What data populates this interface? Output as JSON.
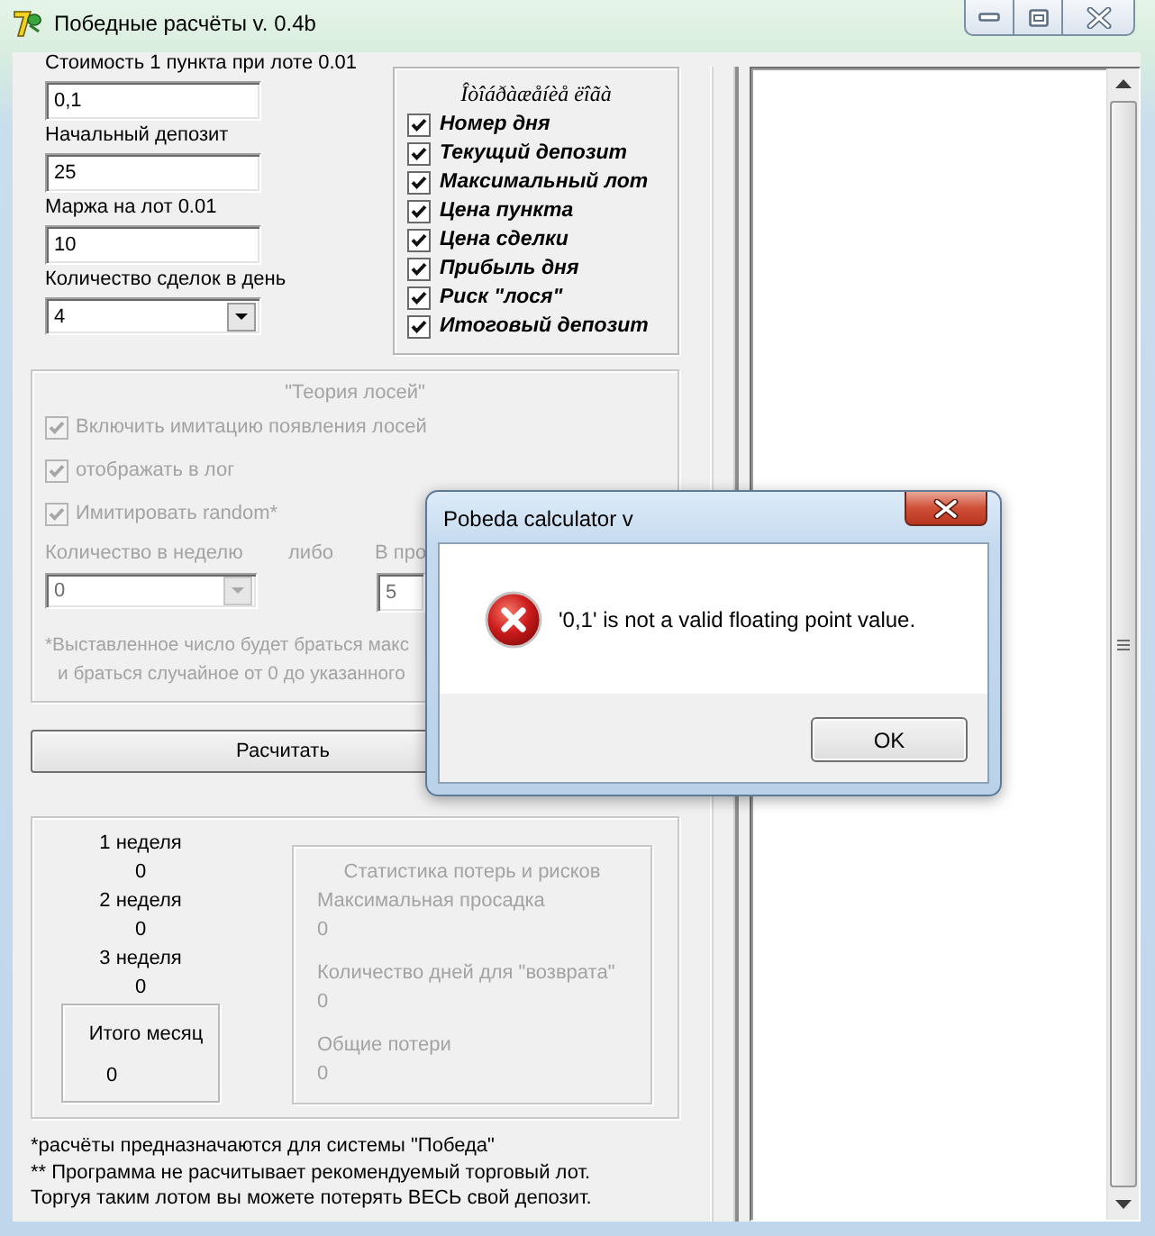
{
  "window": {
    "title": "Победные расчёты v. 0.4b"
  },
  "inputs": [
    {
      "label": "Стоимость 1 пункта при лоте 0.01",
      "kind": "text",
      "value": "0,1"
    },
    {
      "label": "Начальный депозит",
      "kind": "text",
      "value": "25"
    },
    {
      "label": "Маржа на лот 0.01",
      "kind": "text",
      "value": "10"
    },
    {
      "label": "Количество сделок в день",
      "kind": "combo",
      "value": "4"
    }
  ],
  "log_options": {
    "title": "Îòîáðàæåíèå ëîãà",
    "items": [
      {
        "label": "Номер дня",
        "checked": true
      },
      {
        "label": "Текущий депозит",
        "checked": true
      },
      {
        "label": "Максимальный лот",
        "checked": true
      },
      {
        "label": "Цена пункта",
        "checked": true
      },
      {
        "label": "Цена сделки",
        "checked": true
      },
      {
        "label": "Прибыль дня",
        "checked": true
      },
      {
        "label": "Риск \"лося\"",
        "checked": true
      },
      {
        "label": "Итоговый депозит",
        "checked": true
      }
    ]
  },
  "moose_theory": {
    "title": "\"Теория лосей\"",
    "disabled": true,
    "options": [
      {
        "label": "Включить имитацию появления лосей",
        "checked": true
      },
      {
        "label": "отображать в лог",
        "checked": true
      },
      {
        "label": "Имитировать random*",
        "checked": true
      }
    ],
    "fields": [
      {
        "label": "Количество в неделю",
        "kind": "combo",
        "value": "0"
      },
      {
        "label": "В про",
        "kind": "text",
        "value": "5"
      }
    ],
    "or_label": "либо",
    "note": [
      "*Выставленное число будет браться макс",
      "и браться случайное от 0 до указанного"
    ]
  },
  "calculate_button": {
    "label": "Расчитать"
  },
  "results": {
    "weeks": [
      {
        "label": "1 неделя",
        "value": "0"
      },
      {
        "label": "2 неделя",
        "value": "0"
      },
      {
        "label": "3 неделя",
        "value": "0"
      }
    ],
    "month": {
      "label": "Итого месяц",
      "value": "0"
    },
    "stats": {
      "title": "Статистика потерь и рисков",
      "disabled": true,
      "items": [
        {
          "label": "Максимальная просадка",
          "value": "0"
        },
        {
          "label": "Количество дней для \"возврата\"",
          "value": "0"
        },
        {
          "label": "Общие потери",
          "value": "0"
        }
      ]
    }
  },
  "footnotes": [
    "*расчёты предназначаются для системы \"Победа\"",
    "** Программа не расчитывает рекомендуемый торговый лот.",
    "Торгуя таким лотом вы можете потерять ВЕСЬ свой депозит."
  ],
  "dialog": {
    "title": "Pobeda calculator v",
    "message": "'0,1' is not a valid floating point value.",
    "buttons": [
      "OK"
    ]
  }
}
